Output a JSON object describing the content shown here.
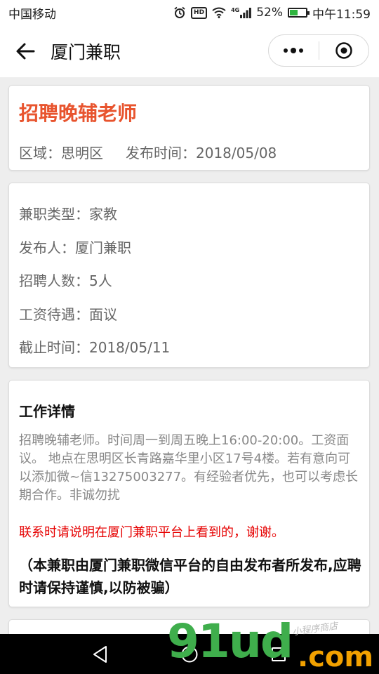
{
  "status_bar": {
    "carrier": "中国移动",
    "network": "4G",
    "battery": "52%",
    "battery_level": 0.52,
    "time": "中午11:59"
  },
  "nav": {
    "title": "厦门兼职"
  },
  "job": {
    "title": "招聘晚辅老师",
    "region": "区域：思明区",
    "publish_time": "发布时间：2018/05/08"
  },
  "info": [
    "兼职类型：家教",
    "发布人：厦门兼职",
    "招聘人数：5人",
    "工资待遇：面议",
    "截止时间：2018/05/11"
  ],
  "details": {
    "heading": "工作详情",
    "body": "招聘晚辅老师。时间周一到周五晚上16:00-20:00。工资面议。 地点在思明区长青路嘉华里小区17号4楼。若有意向可以添加微~信13275003277。有经验者优先，也可以考虑长期合作。非诚勿扰",
    "contact_note": "联系时请说明在厦门兼职平台上看到的，谢谢。",
    "disclaimer": "（本兼职由厦门兼职微信平台的自由发布者所发布,应聘时请保持谨慎,以防被骗）"
  },
  "watermark": {
    "main": "91ud",
    "suffix": ".com",
    "small": "小程序商店"
  },
  "colors": {
    "accent": "#e8542e",
    "warning": "#e60000",
    "watermark_green": "#3fae4c",
    "watermark_orange": "#f2a100"
  }
}
